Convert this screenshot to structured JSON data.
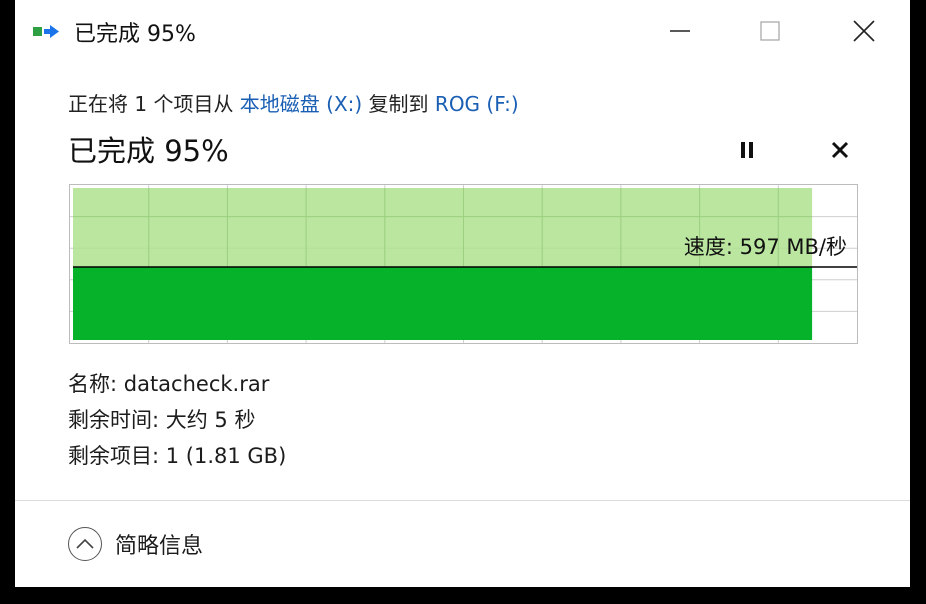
{
  "window": {
    "title": "已完成 95%",
    "icon": "copy-transfer-icon",
    "controls": [
      "minimize-icon",
      "maximize-icon",
      "close-icon"
    ]
  },
  "operation": {
    "prefix": "正在将 1 个项目从 ",
    "source": "本地磁盘 (X:)",
    "middle": " 复制到 ",
    "destination": "ROG (F:)"
  },
  "status": {
    "text": "已完成 95%",
    "percent_complete": 95
  },
  "graph": {
    "speed_label": "速度: 597 MB/秒",
    "progress_fraction": 0.95,
    "speed_line_fraction": 0.52,
    "colors": {
      "band_light": "#aee28f",
      "band_dark": "#06b22a",
      "grid": "#cfcfcf",
      "line": "#000000"
    }
  },
  "details": {
    "name": "名称: datacheck.rar",
    "time_remaining": "剩余时间: 大约 5 秒",
    "items_remaining": "剩余项目: 1 (1.81 GB)"
  },
  "footer": {
    "less_details_label": "简略信息",
    "icon": "chevron-up-icon"
  }
}
